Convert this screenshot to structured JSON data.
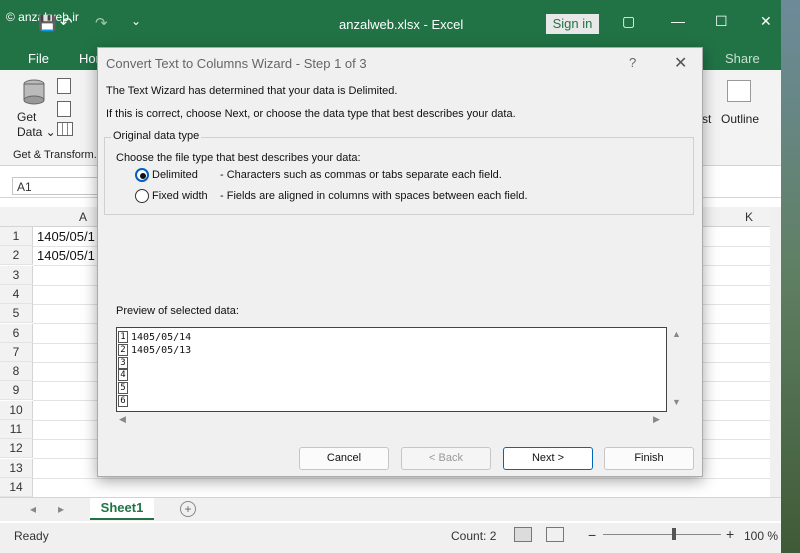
{
  "window": {
    "watermark": "© anzalweb.ir",
    "title": "anzalweb.xlsx  -  Excel",
    "sign_in": "Sign in",
    "qat": {
      "save": "💾",
      "undo": "↶",
      "redo": "↷",
      "customize": "⌄"
    },
    "controls": {
      "ribbon_options": "▢",
      "minimize": "—",
      "maximize": "☐",
      "close": "✕"
    }
  },
  "menu": {
    "file": "File",
    "home": "Hon",
    "share": "Share"
  },
  "ribbon": {
    "get_data": "Get\nData ⌄",
    "get_transform": "Get & Transform...",
    "st": "st",
    "outline": "Outline"
  },
  "formula_bar": {
    "name_box": "A1"
  },
  "columns": {
    "a": "A",
    "k": "K"
  },
  "rows": [
    "1",
    "2",
    "3",
    "4",
    "5",
    "6",
    "7",
    "8",
    "9",
    "10",
    "11",
    "12",
    "13",
    "14"
  ],
  "cells": {
    "a1": "1405/05/1",
    "a2": "1405/05/1"
  },
  "sheet_tab": "Sheet1",
  "status": {
    "ready": "Ready",
    "count": "Count: 2",
    "zoom": "100 %",
    "minus": "−",
    "plus": "+"
  },
  "dialog": {
    "title": "Convert Text to Columns Wizard - Step 1 of 3",
    "help": "?",
    "close": "✕",
    "intro1": "The Text Wizard has determined that your data is Delimited.",
    "intro2": "If this is correct, choose Next, or choose the data type that best describes your data.",
    "group_label": "Original data type",
    "choose_label": "Choose the file type that best describes your data:",
    "options": [
      {
        "label": "Delimited",
        "desc": "- Characters such as commas or tabs separate each field.",
        "selected": true
      },
      {
        "label": "Fixed width",
        "desc": "- Fields are aligned in columns with spaces between each field.",
        "selected": false
      }
    ],
    "preview_label": "Preview of selected data:",
    "preview_rows": [
      {
        "num": "1",
        "text": "1405/05/14"
      },
      {
        "num": "2",
        "text": "1405/05/13"
      },
      {
        "num": "3",
        "text": ""
      },
      {
        "num": "4",
        "text": ""
      },
      {
        "num": "5",
        "text": ""
      },
      {
        "num": "6",
        "text": ""
      }
    ],
    "buttons": {
      "cancel": "Cancel",
      "back": "< Back",
      "next": "Next >",
      "finish": "Finish"
    }
  }
}
